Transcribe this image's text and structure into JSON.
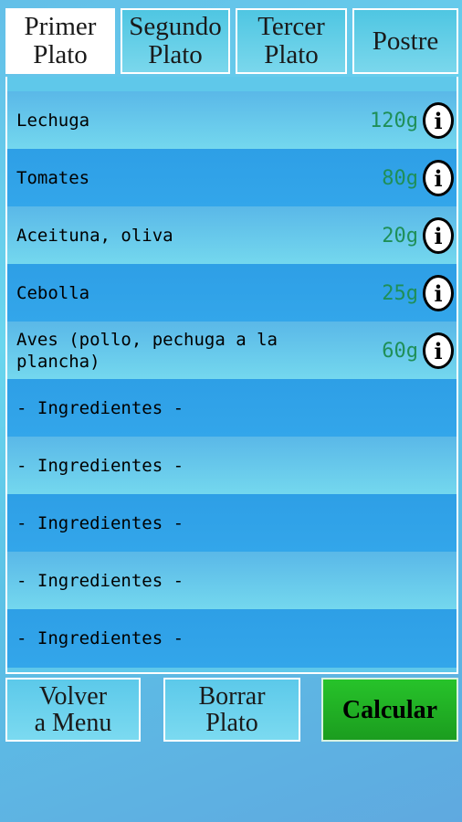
{
  "tabs": [
    {
      "label_line1": "Primer",
      "label_line2": "Plato",
      "active": true
    },
    {
      "label_line1": "Segundo",
      "label_line2": "Plato",
      "active": false
    },
    {
      "label_line1": "Tercer",
      "label_line2": "Plato",
      "active": false
    },
    {
      "label_line1": "Postre",
      "label_line2": "",
      "active": false
    }
  ],
  "ingredients": [
    {
      "name": "Lechuga",
      "quantity": "120g",
      "info_icon": "i"
    },
    {
      "name": "Tomates",
      "quantity": "80g",
      "info_icon": "i"
    },
    {
      "name": "Aceituna, oliva",
      "quantity": "20g",
      "info_icon": "i"
    },
    {
      "name": "Cebolla",
      "quantity": "25g",
      "info_icon": "i"
    },
    {
      "name": "Aves (pollo, pechuga a la plancha)",
      "quantity": "60g",
      "info_icon": "i"
    },
    {
      "name": "- Ingredientes -"
    },
    {
      "name": "- Ingredientes -"
    },
    {
      "name": "- Ingredientes -"
    },
    {
      "name": "- Ingredientes -"
    },
    {
      "name": "- Ingredientes -"
    }
  ],
  "buttons": {
    "volver_line1": "Volver",
    "volver_line2": "a Menu",
    "borrar_line1": "Borrar",
    "borrar_line2": "Plato",
    "calcular": "Calcular"
  },
  "colors": {
    "quantity_text": "#1f8f58",
    "calcular_button": "#1fb024",
    "row_dark": "#2e9fe6"
  }
}
